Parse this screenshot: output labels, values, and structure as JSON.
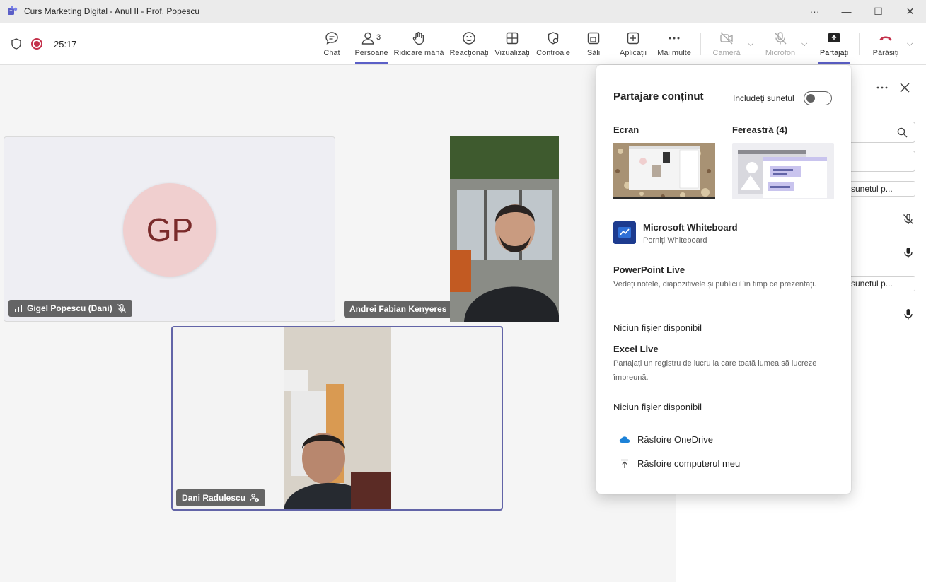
{
  "window": {
    "title": "Curs Marketing Digital - Anul II - Prof. Popescu",
    "controls": {
      "more": "···",
      "minimize": "—",
      "maximize": "☐",
      "close": "✕"
    }
  },
  "meeting": {
    "timer": "25:17"
  },
  "toolbar": {
    "chat": "Chat",
    "people": "Persoane",
    "people_count": "3",
    "raise_hand": "Ridicare mână",
    "reactions": "Reacționați",
    "view": "Vizualizați",
    "controls": "Controale",
    "rooms": "Săli",
    "apps": "Aplicații",
    "more": "Mai multe",
    "camera": "Cameră",
    "mic": "Microfon",
    "share": "Partajați",
    "leave": "Părăsiți"
  },
  "participants": [
    {
      "name": "Gigel Popescu (Dani)",
      "initials": "GP"
    },
    {
      "name": "Andrei Fabian Kenyeres"
    },
    {
      "name": "Dani Radulescu"
    }
  ],
  "side_panel": {
    "pill_1": "ați sunetul p...",
    "pill_2": "ați sunetul p..."
  },
  "share_flyout": {
    "title": "Partajare conținut",
    "include_sound": "Includeți sunetul",
    "include_sound_on": false,
    "screen_label": "Ecran",
    "window_label": "Fereastră (4)",
    "whiteboard": {
      "title": "Microsoft Whiteboard",
      "subtitle": "Porniți Whiteboard"
    },
    "powerpoint": {
      "title": "PowerPoint Live",
      "description": "Vedeți notele, diapozitivele și publicul în timp ce prezentați.",
      "empty": "Niciun fișier disponibil"
    },
    "excel": {
      "title": "Excel Live",
      "description": "Partajați un registru de lucru la care toată lumea să lucreze împreună.",
      "empty": "Niciun fișier disponibil"
    },
    "browse_onedrive": "Răsfoire OneDrive",
    "browse_computer": "Răsfoire computerul meu"
  },
  "colors": {
    "accent": "#5b5fc7",
    "record": "#c4314b",
    "leave": "#c4314b",
    "avatar_bg": "#f0cfcf",
    "avatar_text": "#7a2b2b"
  }
}
